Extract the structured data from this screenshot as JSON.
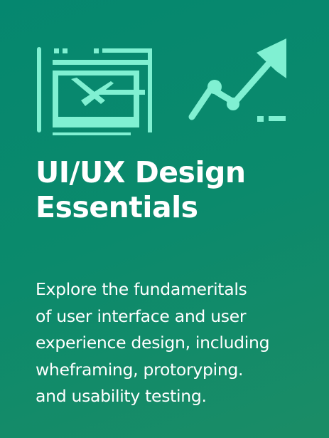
{
  "card": {
    "icons": [
      "wireframe-icon",
      "growth-chart-icon"
    ],
    "accent_color": "#80f0d2",
    "title_line1": "UI/UX Design",
    "title_line2": "Essentials",
    "description_lines": [
      "Explore the fundameritals",
      "of user interface and user",
      "experience design, including",
      "wheframing, protoryping.",
      "and usability testing."
    ]
  }
}
